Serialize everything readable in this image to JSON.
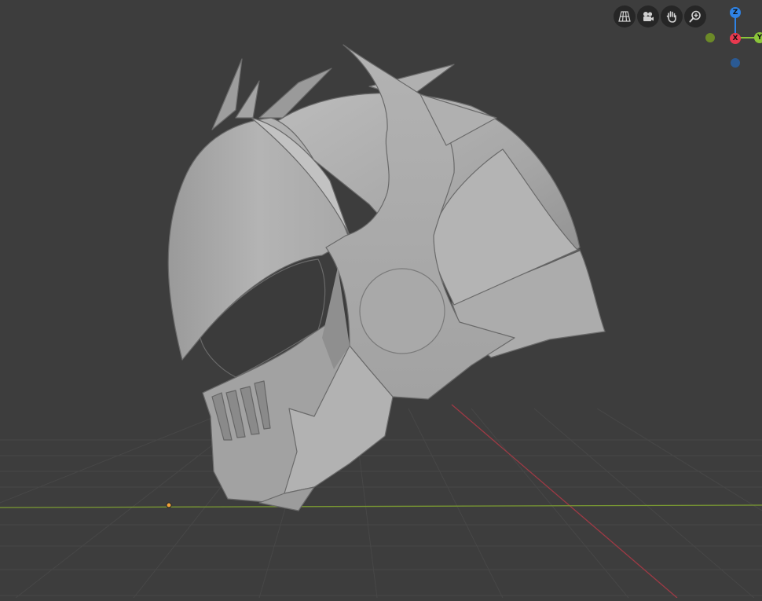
{
  "viewport": {
    "background": "#3d3d3d",
    "grid_color": "#4a4a4a",
    "x_axis_color": "#9e3a45",
    "y_axis_color": "#7a9a32"
  },
  "nav_buttons": [
    {
      "name": "toggle-grid-view-button",
      "icon": "grid-perspective-icon"
    },
    {
      "name": "toggle-camera-view-button",
      "icon": "camera-icon"
    },
    {
      "name": "pan-view-button",
      "icon": "hand-icon"
    },
    {
      "name": "zoom-view-button",
      "icon": "magnifier-zoom-icon"
    }
  ],
  "gizmo": {
    "z_label": "Z",
    "x_label": "X",
    "y_label": "Y",
    "z_color": "#2f83e5",
    "x_color": "#e8394f",
    "y_color": "#8bc53a",
    "neg_x_color": "#6c8a28",
    "neg_z_color": "#2b5a93"
  },
  "model": {
    "name": "helmet-mesh",
    "base_color": "#a9a9a9"
  }
}
